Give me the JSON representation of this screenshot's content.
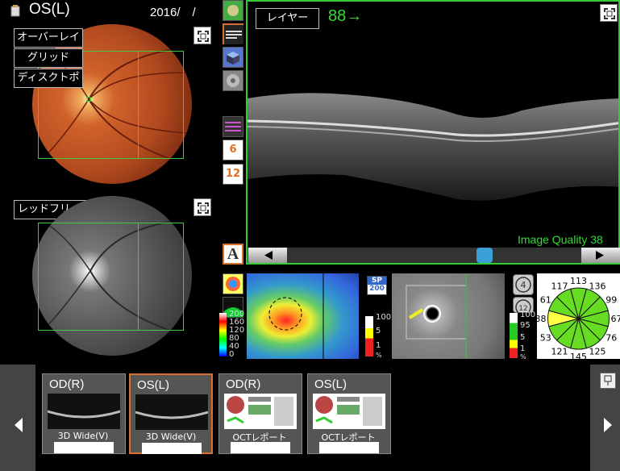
{
  "header": {
    "eye": "OS(L)",
    "date": "2016/　/"
  },
  "fundus": {
    "menu": [
      "オーバーレイ",
      "グリッド",
      "ディスクトポ"
    ],
    "redfree_label": "レッドフリー"
  },
  "oct": {
    "layer_label": "レイヤー",
    "slice_number": "88",
    "slice_arrow": "→",
    "quality_text": "Image Quality 38"
  },
  "tools": {
    "num_6": "6",
    "num_12": "12",
    "a_button": "A"
  },
  "thickness_scale": {
    "values": [
      "200",
      "160",
      "120",
      "80",
      "40",
      "0"
    ],
    "colors": [
      "#ffffff",
      "#ff0000",
      "#ffff00",
      "#00ff00",
      "#00ffff",
      "#0000ff"
    ]
  },
  "sp_badge": {
    "top": "SP",
    "bottom": "200"
  },
  "deviation_scale_1": {
    "values": [
      "100",
      "5",
      "1"
    ],
    "unit": "%"
  },
  "deviation_scale_2": {
    "values": [
      "100",
      "95",
      "5",
      "1"
    ],
    "unit": "%"
  },
  "clock_buttons": [
    "4",
    "12"
  ],
  "clock_chart": {
    "values": [
      {
        "hour": "12",
        "value": "113"
      },
      {
        "hour": "1",
        "value": "136"
      },
      {
        "hour": "2",
        "value": "99"
      },
      {
        "hour": "3",
        "value": "67"
      },
      {
        "hour": "4",
        "value": "76"
      },
      {
        "hour": "5",
        "value": "125"
      },
      {
        "hour": "6",
        "value": "145"
      },
      {
        "hour": "7",
        "value": "121"
      },
      {
        "hour": "8",
        "value": "53"
      },
      {
        "hour": "9",
        "value": "38"
      },
      {
        "hour": "10",
        "value": "61"
      },
      {
        "hour": "11",
        "value": "117"
      }
    ]
  },
  "thumbnails": [
    {
      "eye": "OD(R)",
      "caption": "3D Wide(V)",
      "selected": false
    },
    {
      "eye": "OS(L)",
      "caption": "3D Wide(V)",
      "selected": true
    },
    {
      "eye": "OD(R)",
      "caption": "OCTレポート",
      "selected": false
    },
    {
      "eye": "OS(L)",
      "caption": "OCTレポート",
      "selected": false
    }
  ],
  "colors": {
    "accent_green": "#33cc33",
    "quality_green": "#33dd33",
    "selected_border": "#d87030"
  }
}
